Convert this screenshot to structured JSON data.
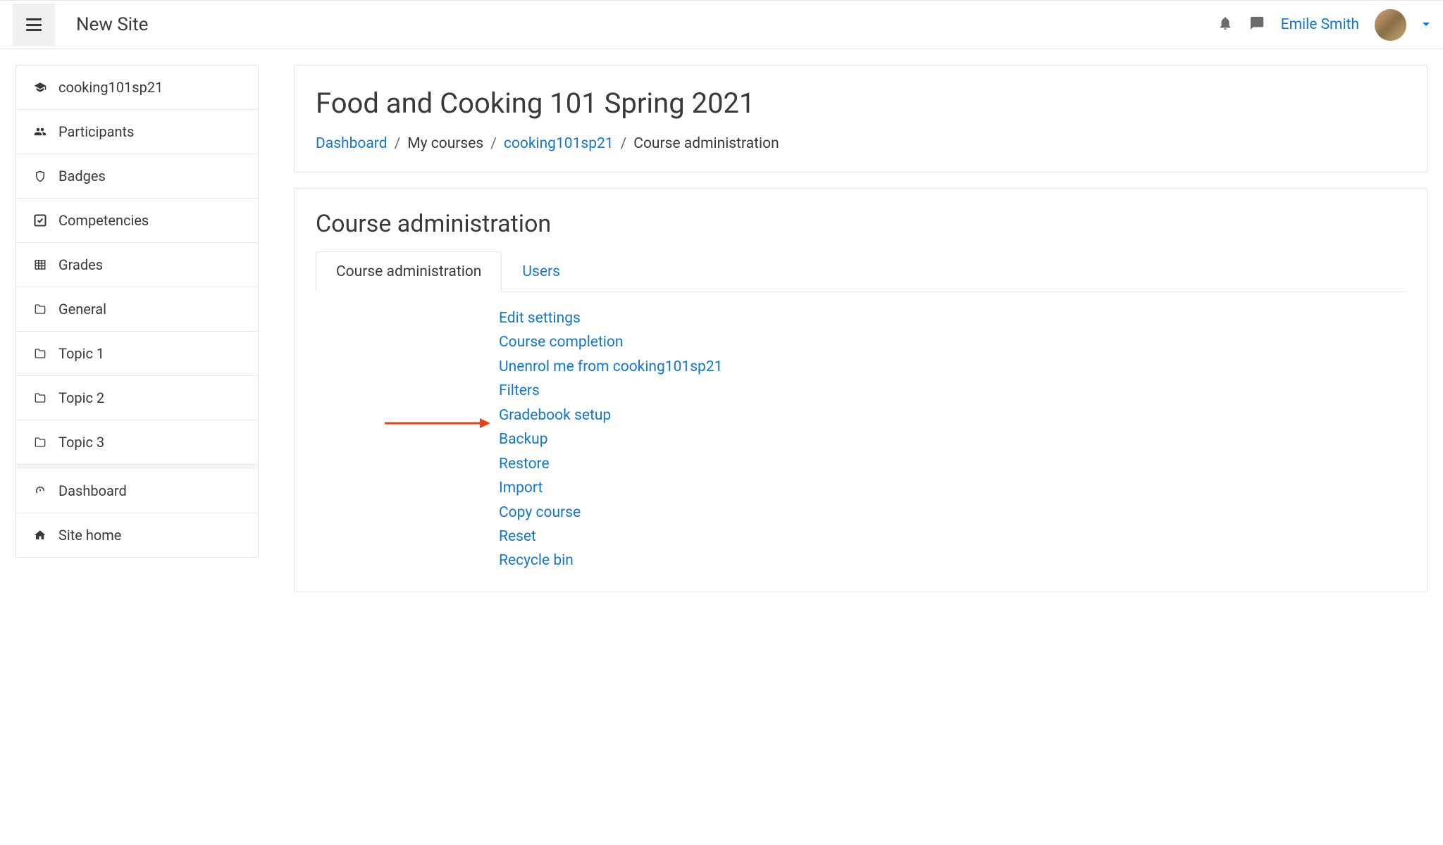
{
  "header": {
    "site_title": "New Site",
    "user_name": "Emile Smith"
  },
  "sidebar": {
    "items": [
      {
        "icon": "graduation-cap-icon",
        "label": "cooking101sp21"
      },
      {
        "icon": "users-icon",
        "label": "Participants"
      },
      {
        "icon": "shield-icon",
        "label": "Badges"
      },
      {
        "icon": "check-square-icon",
        "label": "Competencies"
      },
      {
        "icon": "grid-icon",
        "label": "Grades"
      },
      {
        "icon": "folder-icon",
        "label": "General"
      },
      {
        "icon": "folder-icon",
        "label": "Topic 1"
      },
      {
        "icon": "folder-icon",
        "label": "Topic 2"
      },
      {
        "icon": "folder-icon",
        "label": "Topic 3"
      },
      {
        "icon": "gauge-icon",
        "label": "Dashboard"
      },
      {
        "icon": "home-icon",
        "label": "Site home"
      }
    ]
  },
  "main": {
    "title": "Food and Cooking 101 Spring 2021",
    "breadcrumb": {
      "dashboard": "Dashboard",
      "my_courses": "My courses",
      "course_short": "cooking101sp21",
      "current": "Course administration"
    },
    "section_title": "Course administration",
    "tabs": [
      {
        "label": "Course administration"
      },
      {
        "label": "Users"
      }
    ],
    "admin_links": [
      "Edit settings",
      "Course completion",
      "Unenrol me from cooking101sp21",
      "Filters",
      "Gradebook setup",
      "Backup",
      "Restore",
      "Import",
      "Copy course",
      "Reset",
      "Recycle bin"
    ]
  }
}
